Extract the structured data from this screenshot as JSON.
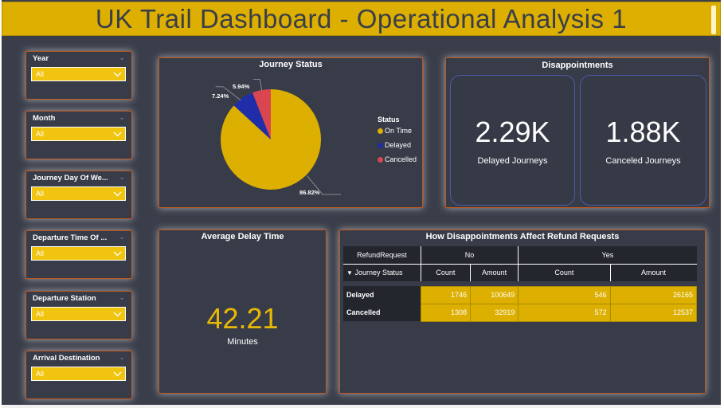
{
  "title": "UK Trail Dashboard - Operational Analysis 1",
  "slicers": [
    {
      "label": "Year",
      "value": "All"
    },
    {
      "label": "Month",
      "value": "All"
    },
    {
      "label": "Journey Day Of We...",
      "value": "All"
    },
    {
      "label": "Departure Time Of ...",
      "value": "All"
    },
    {
      "label": "Departure Station",
      "value": "All"
    },
    {
      "label": "Arrival Destination",
      "value": "All"
    }
  ],
  "journey_status": {
    "title": "Journey Status",
    "legend_title": "Status",
    "legend": [
      "On Time",
      "Delayed",
      "Cancelled"
    ],
    "colors": [
      "#dcaf00",
      "#1f2ea8",
      "#d9464f"
    ],
    "labels": [
      "86.82%",
      "7.24%",
      "5.94%"
    ]
  },
  "chart_data": {
    "type": "pie",
    "title": "Journey Status",
    "categories": [
      "On Time",
      "Delayed",
      "Cancelled"
    ],
    "values": [
      86.82,
      7.24,
      5.94
    ]
  },
  "disappointments": {
    "title": "Disappointments",
    "delayed_value": "2.29K",
    "delayed_caption": "Delayed Journeys",
    "canceled_value": "1.88K",
    "canceled_caption": "Canceled Journeys"
  },
  "avg_delay": {
    "title": "Average Delay Time",
    "value": "42.21",
    "unit": "Minutes"
  },
  "refund": {
    "title": "How Disappointments Affect Refund Requests",
    "header_row1": [
      "RefundRequest",
      "No",
      "Yes"
    ],
    "header_row2": [
      "Journey Status",
      "Count",
      "Amount",
      "Count",
      "Amount"
    ],
    "rows": [
      {
        "status": "Delayed",
        "values": [
          "1746",
          "100649",
          "546",
          "26165"
        ]
      },
      {
        "status": "Cancelled",
        "values": [
          "1308",
          "32919",
          "572",
          "12537"
        ]
      }
    ]
  }
}
